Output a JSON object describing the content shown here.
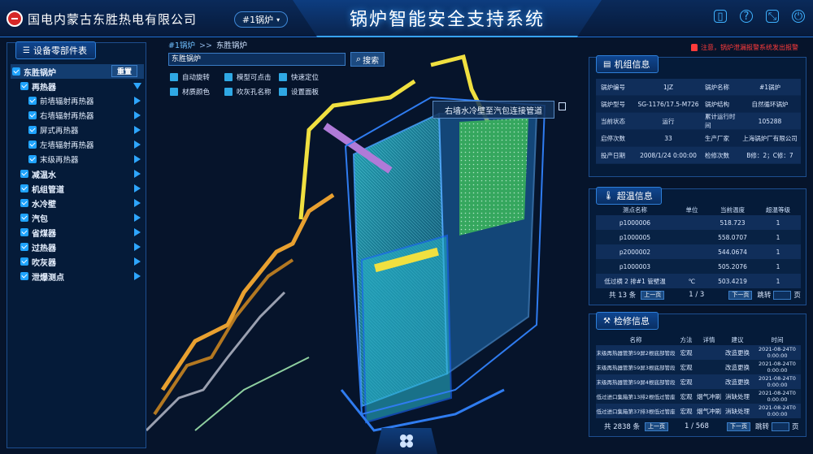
{
  "header": {
    "brand": "国电内蒙古东胜热电有限公司",
    "unit_select": "#1锅炉",
    "title": "锅炉智能安全支持系统"
  },
  "left_panel": {
    "title": "设备零部件表",
    "reset_label": "重置",
    "tree": [
      {
        "label": "东胜锅炉",
        "level": 0
      },
      {
        "label": "再热器",
        "level": 1
      },
      {
        "label": "前墙辐射再热器",
        "level": 2
      },
      {
        "label": "右墙辐射再热器",
        "level": 2
      },
      {
        "label": "屏式再热器",
        "level": 2
      },
      {
        "label": "左墙辐射再热器",
        "level": 2
      },
      {
        "label": "末级再热器",
        "level": 2
      },
      {
        "label": "减温水",
        "level": 1
      },
      {
        "label": "机组管道",
        "level": 1
      },
      {
        "label": "水冷壁",
        "level": 1
      },
      {
        "label": "汽包",
        "level": 1
      },
      {
        "label": "省煤器",
        "level": 1
      },
      {
        "label": "过热器",
        "level": 1
      },
      {
        "label": "吹灰器",
        "level": 1
      },
      {
        "label": "泄爆测点",
        "level": 1
      }
    ]
  },
  "toolbar": {
    "breadcrumb_root": "#1锅炉",
    "breadcrumb_sep": ">>",
    "breadcrumb_current": "东胜锅炉",
    "search_value": "东胜锅炉",
    "search_label": "搜索",
    "options": [
      "自动旋转",
      "模型可点击",
      "快速定位",
      "材质颜色",
      "吹灰孔名称",
      "设置面板"
    ]
  },
  "model": {
    "tooltip": "右墙水冷壁至汽包连接管道"
  },
  "alarm": "注意，锅炉泄漏报警系统发出报警",
  "unit_info": {
    "title": "机组信息",
    "rows": [
      {
        "k1": "锅炉编号",
        "v1": "1JZ",
        "k2": "锅炉名称",
        "v2": "#1锅炉"
      },
      {
        "k1": "锅炉型号",
        "v1": "SG-1176/17.5-M726",
        "k2": "锅炉结构",
        "v2": "自然循环锅炉"
      },
      {
        "k1": "当前状态",
        "v1": "运行",
        "k2": "累计运行时间",
        "v2": "105288"
      },
      {
        "k1": "启停次数",
        "v1": "33",
        "k2": "生产厂家",
        "v2": "上海锅炉厂有限公司"
      },
      {
        "k1": "投产日期",
        "v1": "2008/1/24 0:00:00",
        "k2": "检修次数",
        "v2": "B修：2；C修：7"
      }
    ]
  },
  "overtemp": {
    "title": "超温信息",
    "headers": [
      "测点名称",
      "单位",
      "当前温度",
      "超温等级"
    ],
    "rows": [
      {
        "name": "p1000006",
        "unit": "",
        "temp": "518.723",
        "level": "1"
      },
      {
        "name": "p1000005",
        "unit": "",
        "temp": "558.0707",
        "level": "1"
      },
      {
        "name": "p2000002",
        "unit": "",
        "temp": "544.0674",
        "level": "1"
      },
      {
        "name": "p1000003",
        "unit": "",
        "temp": "505.2076",
        "level": "1"
      },
      {
        "name": "低过横 2 排#1 管壁温",
        "unit": "℃",
        "temp": "503.4219",
        "level": "1"
      }
    ],
    "total": "共 13 条",
    "prev": "上一页",
    "page": "1 / 3",
    "next": "下一页",
    "jump": "跳转",
    "page_unit": "页"
  },
  "maintenance": {
    "title": "检修信息",
    "headers": [
      "名称",
      "方法",
      "详情",
      "建议",
      "时间"
    ],
    "rows": [
      {
        "name": "末级再热器管第59屏2根底部管段",
        "method": "宏观",
        "detail": "",
        "advice": "改造更换",
        "time": "2021-08-24T0 0:00:00"
      },
      {
        "name": "末级再热器管第59屏3根底部管段",
        "method": "宏观",
        "detail": "",
        "advice": "改造更换",
        "time": "2021-08-24T0 0:00:00"
      },
      {
        "name": "末级再热器管第59屏4根底部管段",
        "method": "宏观",
        "detail": "",
        "advice": "改造更换",
        "time": "2021-08-24T0 0:00:00"
      },
      {
        "name": "低过进口集箱第13排2根低过管座",
        "method": "宏观",
        "detail": "烟气冲刷",
        "advice": "消缺处理",
        "time": "2021-08-24T0 0:00:00"
      },
      {
        "name": "低过进口集箱第37排3根低过管座",
        "method": "宏观",
        "detail": "烟气冲刷",
        "advice": "消缺处理",
        "time": "2021-08-24T0 0:00:00"
      }
    ],
    "total": "共 2838 条",
    "prev": "上一页",
    "page": "1 / 568",
    "next": "下一页",
    "jump": "跳转",
    "page_unit": "页"
  }
}
